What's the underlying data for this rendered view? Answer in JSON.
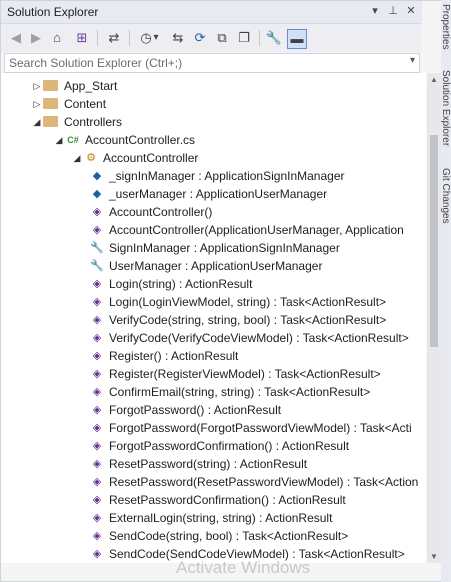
{
  "window": {
    "title": "Solution Explorer",
    "buttons": [
      {
        "name": "dropdown-icon",
        "glyph": "▾"
      },
      {
        "name": "pin-icon",
        "glyph": "⊥"
      },
      {
        "name": "close-icon",
        "glyph": "✕"
      }
    ]
  },
  "toolbar": {
    "icons": [
      {
        "name": "back-icon",
        "glyph": "◀"
      },
      {
        "name": "forward-icon",
        "glyph": "▶"
      },
      {
        "name": "home-icon",
        "glyph": "⌂"
      },
      {
        "name": "switch-views-icon",
        "glyph": "⊞"
      },
      {
        "name": "sync-icon",
        "glyph": "⇄"
      },
      {
        "name": "pending-changes-icon",
        "glyph": "◷"
      },
      {
        "name": "dropdown-icon",
        "glyph": "▾"
      },
      {
        "name": "sync-with-document-icon",
        "glyph": "⇆"
      },
      {
        "name": "refresh-icon",
        "glyph": "⟳"
      },
      {
        "name": "collapse-all-icon",
        "glyph": "⧉"
      },
      {
        "name": "show-all-files-icon",
        "glyph": "❐"
      },
      {
        "name": "properties-icon",
        "glyph": "🔧"
      },
      {
        "name": "preview-icon",
        "glyph": "▬"
      }
    ]
  },
  "search": {
    "placeholder": "Search Solution Explorer (Ctrl+;)",
    "dropdown_glyph": "▾"
  },
  "tree": {
    "items": [
      {
        "label": "App_Start",
        "expander": "▷",
        "icon": "folder",
        "indent": 0
      },
      {
        "label": "Content",
        "expander": "▷",
        "icon": "folder",
        "indent": 0
      },
      {
        "label": "Controllers",
        "expander": "◢",
        "icon": "folder",
        "indent": 0
      },
      {
        "label": "AccountController.cs",
        "expander": "◢",
        "icon": "cs-file",
        "glyph": "C#",
        "indent": 1
      },
      {
        "label": "AccountController",
        "expander": "◢",
        "icon": "class",
        "glyph": "⚙",
        "indent": 2
      },
      {
        "label": "_signInManager : ApplicationSignInManager",
        "icon": "private-field",
        "glyph": "◆",
        "indent": 3
      },
      {
        "label": "_userManager : ApplicationUserManager",
        "icon": "private-field",
        "glyph": "◆",
        "indent": 3
      },
      {
        "label": "AccountController()",
        "icon": "method",
        "glyph": "◈",
        "indent": 3
      },
      {
        "label": "AccountController(ApplicationUserManager, Application",
        "icon": "method",
        "glyph": "◈",
        "indent": 3
      },
      {
        "label": "SignInManager : ApplicationSignInManager",
        "icon": "property",
        "glyph": "🔧",
        "indent": 3
      },
      {
        "label": "UserManager : ApplicationUserManager",
        "icon": "property",
        "glyph": "🔧",
        "indent": 3
      },
      {
        "label": "Login(string) : ActionResult",
        "icon": "method",
        "glyph": "◈",
        "indent": 3
      },
      {
        "label": "Login(LoginViewModel, string) : Task<ActionResult>",
        "icon": "method",
        "glyph": "◈",
        "indent": 3
      },
      {
        "label": "VerifyCode(string, string, bool) : Task<ActionResult>",
        "icon": "method",
        "glyph": "◈",
        "indent": 3
      },
      {
        "label": "VerifyCode(VerifyCodeViewModel) : Task<ActionResult>",
        "icon": "method",
        "glyph": "◈",
        "indent": 3
      },
      {
        "label": "Register() : ActionResult",
        "icon": "method",
        "glyph": "◈",
        "indent": 3
      },
      {
        "label": "Register(RegisterViewModel) : Task<ActionResult>",
        "icon": "method",
        "glyph": "◈",
        "indent": 3
      },
      {
        "label": "ConfirmEmail(string, string) : Task<ActionResult>",
        "icon": "method",
        "glyph": "◈",
        "indent": 3
      },
      {
        "label": "ForgotPassword() : ActionResult",
        "icon": "method",
        "glyph": "◈",
        "indent": 3
      },
      {
        "label": "ForgotPassword(ForgotPasswordViewModel) : Task<Acti",
        "icon": "method",
        "glyph": "◈",
        "indent": 3
      },
      {
        "label": "ForgotPasswordConfirmation() : ActionResult",
        "icon": "method",
        "glyph": "◈",
        "indent": 3
      },
      {
        "label": "ResetPassword(string) : ActionResult",
        "icon": "method",
        "glyph": "◈",
        "indent": 3
      },
      {
        "label": "ResetPassword(ResetPasswordViewModel) : Task<Action",
        "icon": "method",
        "glyph": "◈",
        "indent": 3
      },
      {
        "label": "ResetPasswordConfirmation() : ActionResult",
        "icon": "method",
        "glyph": "◈",
        "indent": 3
      },
      {
        "label": "ExternalLogin(string, string) : ActionResult",
        "icon": "method",
        "glyph": "◈",
        "indent": 3
      },
      {
        "label": "SendCode(string, bool) : Task<ActionResult>",
        "icon": "method",
        "glyph": "◈",
        "indent": 3
      },
      {
        "label": "SendCode(SendCodeViewModel) : Task<ActionResult>",
        "icon": "method",
        "glyph": "◈",
        "indent": 3
      }
    ]
  },
  "side_tabs": [
    "Properties",
    "Solution Explorer",
    "Git Changes"
  ],
  "watermark": "Activate Windows",
  "colors": {
    "folder": "#dcb67a",
    "method": "#652d90",
    "field": "#1e5fa8",
    "class": "#c27d1a",
    "cs_file": "#388a34"
  }
}
